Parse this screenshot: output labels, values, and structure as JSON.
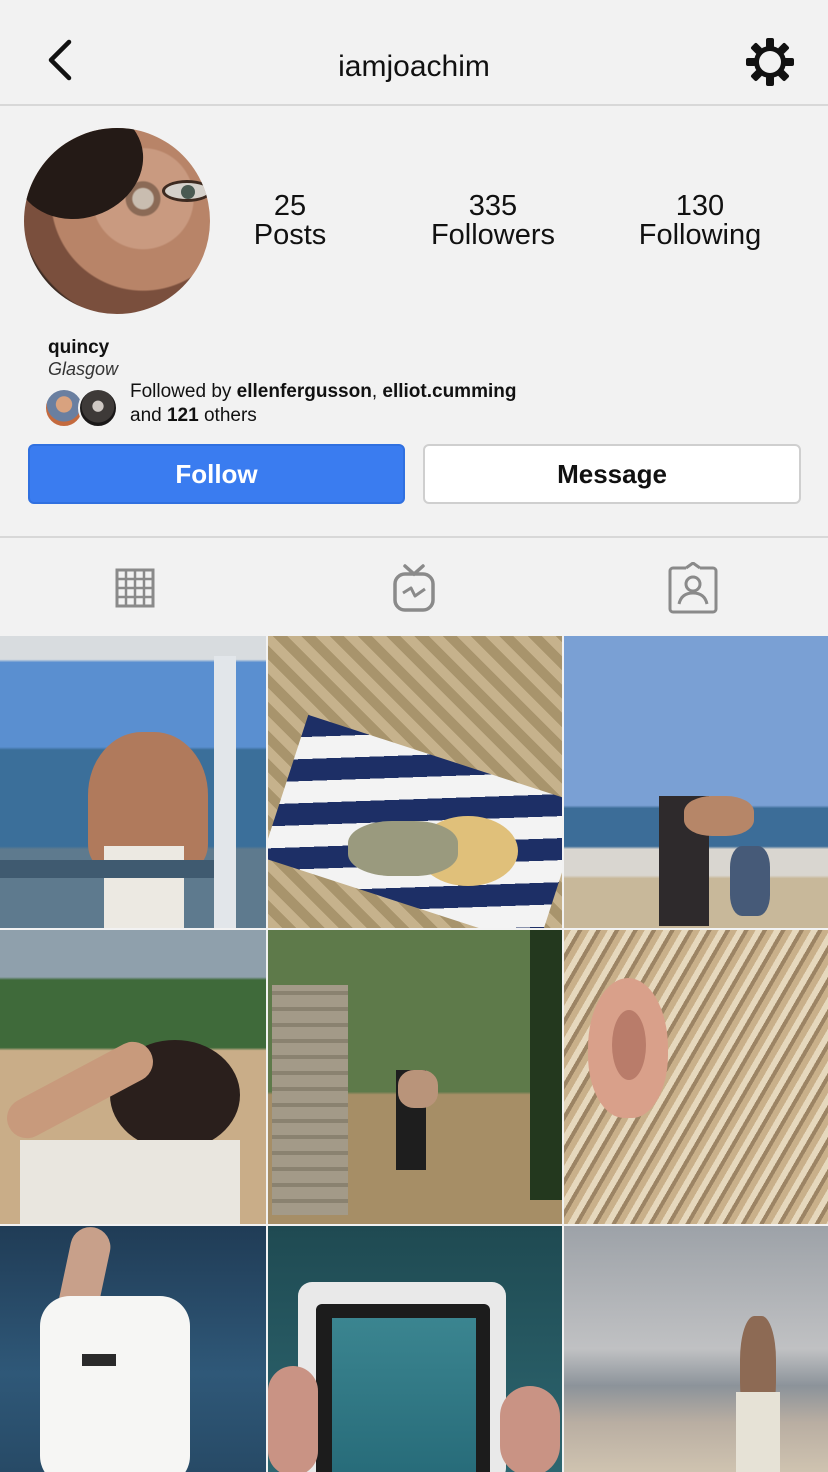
{
  "header": {
    "username": "iamjoachim",
    "back_icon": "chevron-left-icon",
    "settings_icon": "gear-icon"
  },
  "profile": {
    "stats": [
      {
        "value": "25",
        "label": "Posts"
      },
      {
        "value": "335",
        "label": "Followers"
      },
      {
        "value": "130",
        "label": "Following"
      }
    ],
    "name": "quincy",
    "location": "Glasgow",
    "followed_by": {
      "prefix": "Followed by",
      "user1": "ellenfergusson",
      "separator": ",",
      "user2": "elliot.cumming",
      "and": "and",
      "count": "121",
      "suffix": "others"
    }
  },
  "actions": {
    "follow_label": "Follow",
    "message_label": "Message"
  },
  "tabs": [
    {
      "icon": "grid-icon"
    },
    {
      "icon": "igtv-icon"
    },
    {
      "icon": "tagged-icon"
    }
  ],
  "colors": {
    "follow_button": "#3a7cf0",
    "background": "#f2f2f2"
  },
  "posts": [
    {
      "description": "man on balcony overlooking sea"
    },
    {
      "description": "child sleeping in hammock"
    },
    {
      "description": "man holding child's hand on beach"
    },
    {
      "description": "person holding hair, bushes behind"
    },
    {
      "description": "man holding baby near stone wall"
    },
    {
      "description": "close-up of ear and blond hair"
    },
    {
      "description": "arm raised over sea wearing watch"
    },
    {
      "description": "hand holding Nikon camera screen"
    },
    {
      "description": "man walking on beach at dusk"
    }
  ]
}
